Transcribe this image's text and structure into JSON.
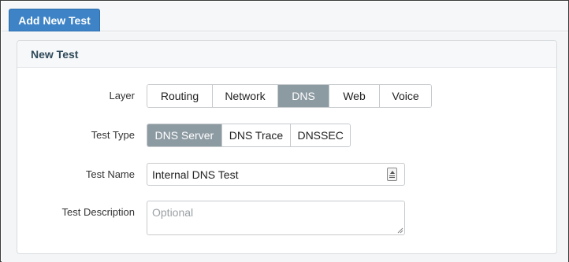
{
  "tabs": {
    "active_label": "Add New Test"
  },
  "panel": {
    "title": "New Test"
  },
  "form": {
    "layer": {
      "label": "Layer",
      "options": [
        "Routing",
        "Network",
        "DNS",
        "Web",
        "Voice"
      ],
      "selected": "DNS"
    },
    "test_type": {
      "label": "Test Type",
      "options": [
        "DNS Server",
        "DNS Trace",
        "DNSSEC"
      ],
      "selected": "DNS Server"
    },
    "test_name": {
      "label": "Test Name",
      "value": "Internal DNS Test"
    },
    "test_description": {
      "label": "Test Description",
      "placeholder": "Optional",
      "value": ""
    }
  },
  "icons": {
    "input_trailing": "contact-card-icon",
    "textarea_grip": "resize-grip-icon"
  },
  "colors": {
    "tab_active_bg": "#3d83c6",
    "segment_active_bg": "#8c9aa2",
    "panel_title": "#2f4a5a"
  }
}
